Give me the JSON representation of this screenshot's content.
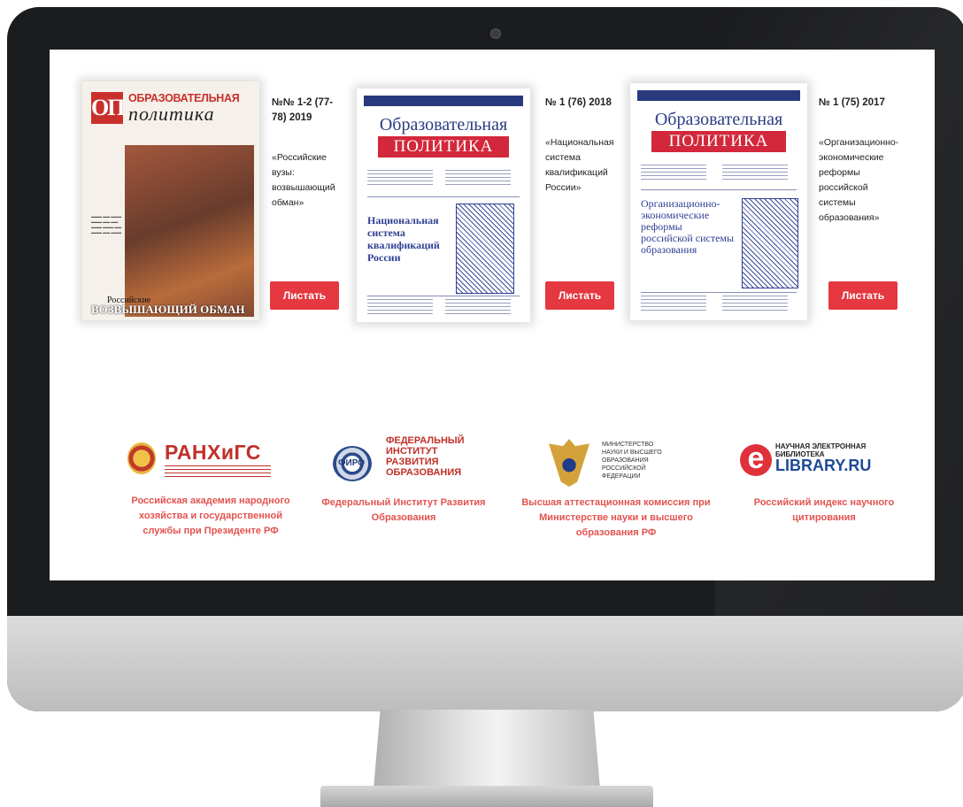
{
  "magazines": [
    {
      "issue": "№№ 1-2 (77-78) 2019",
      "description": "«Российские вузы: возвышающий обман»",
      "button": "Листать",
      "cover": {
        "logo_mark": "ОП",
        "title_line1": "ОБРАЗОВАТЕЛЬНАЯ",
        "title_line2": "политика",
        "subtitle": "Российские",
        "headline": "ВОЗВЫШАЮЩИЙ ОБМАН"
      }
    },
    {
      "issue": "№ 1 (76) 2018",
      "description": "«Национальная система квалификаций России»",
      "button": "Листать",
      "cover": {
        "title_line1": "Образовательная",
        "title_line2": "ПОЛИТИКА",
        "headline": "Национальная система квалификаций России"
      }
    },
    {
      "issue": "№ 1 (75) 2017",
      "description": "«Организационно-экономические реформы российской системы образования»",
      "button": "Листать",
      "cover": {
        "title_line1": "Образовательная",
        "title_line2": "ПОЛИТИКА",
        "headline": "Организационно-экономические реформы российской системы образования"
      }
    }
  ],
  "partners": [
    {
      "logo_text": "РАНХиГС",
      "name": "Российская академия народного хозяйства и государственной службы при Президенте РФ"
    },
    {
      "logo_text": "ФЕДЕРАЛЬНЫЙ ИНСТИТУТ РАЗВИТИЯ ОБРАЗОВАНИЯ",
      "logo_badge": "ФИРО",
      "name": "Федеральный Институт Развития Образования"
    },
    {
      "logo_text": "МИНИСТЕРСТВО НАУКИ И ВЫСШЕГО ОБРАЗОВАНИЯ РОССИЙСКОЙ ФЕДЕРАЦИИ",
      "name": "Высшая аттестационная комиссия при Министерстве науки и высшего образования РФ"
    },
    {
      "logo_text_top": "НАУЧНАЯ ЭЛЕКТРОННАЯ БИБЛИОТЕКА",
      "logo_text": "LIBRARY.RU",
      "logo_mark": "e",
      "name": "Российский индекс научного цитирования"
    }
  ],
  "colors": {
    "accent": "#e53840",
    "partner_text": "#e2534f",
    "cover_blue": "#2b3d84",
    "cover_red": "#d3283b"
  }
}
